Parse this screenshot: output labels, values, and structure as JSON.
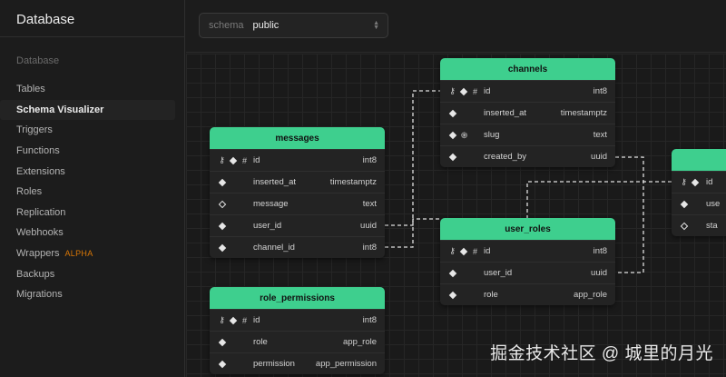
{
  "sidebar": {
    "title": "Database",
    "section_label": "Database",
    "items": [
      {
        "label": "Tables"
      },
      {
        "label": "Schema Visualizer"
      },
      {
        "label": "Triggers"
      },
      {
        "label": "Functions"
      },
      {
        "label": "Extensions"
      },
      {
        "label": "Roles"
      },
      {
        "label": "Replication"
      },
      {
        "label": "Webhooks"
      },
      {
        "label": "Wrappers",
        "badge": "ALPHA"
      },
      {
        "label": "Backups"
      },
      {
        "label": "Migrations"
      }
    ]
  },
  "schema_select": {
    "label": "schema",
    "value": "public"
  },
  "tables": {
    "messages": {
      "name": "messages",
      "columns": [
        {
          "name": "id",
          "type": "int8"
        },
        {
          "name": "inserted_at",
          "type": "timestamptz"
        },
        {
          "name": "message",
          "type": "text"
        },
        {
          "name": "user_id",
          "type": "uuid"
        },
        {
          "name": "channel_id",
          "type": "int8"
        }
      ]
    },
    "channels": {
      "name": "channels",
      "columns": [
        {
          "name": "id",
          "type": "int8"
        },
        {
          "name": "inserted_at",
          "type": "timestamptz"
        },
        {
          "name": "slug",
          "type": "text"
        },
        {
          "name": "created_by",
          "type": "uuid"
        }
      ]
    },
    "user_roles": {
      "name": "user_roles",
      "columns": [
        {
          "name": "id",
          "type": "int8"
        },
        {
          "name": "user_id",
          "type": "uuid"
        },
        {
          "name": "role",
          "type": "app_role"
        }
      ]
    },
    "role_permissions": {
      "name": "role_permissions",
      "columns": [
        {
          "name": "id",
          "type": "int8"
        },
        {
          "name": "role",
          "type": "app_role"
        },
        {
          "name": "permission",
          "type": "app_permission"
        }
      ]
    },
    "users": {
      "columns": [
        {
          "name": "id"
        },
        {
          "name": "use"
        },
        {
          "name": "sta"
        }
      ]
    }
  },
  "colors": {
    "accent": "#3ecf8e",
    "badge": "#d97706"
  },
  "watermark": "掘金技术社区 @ 城里的月光"
}
